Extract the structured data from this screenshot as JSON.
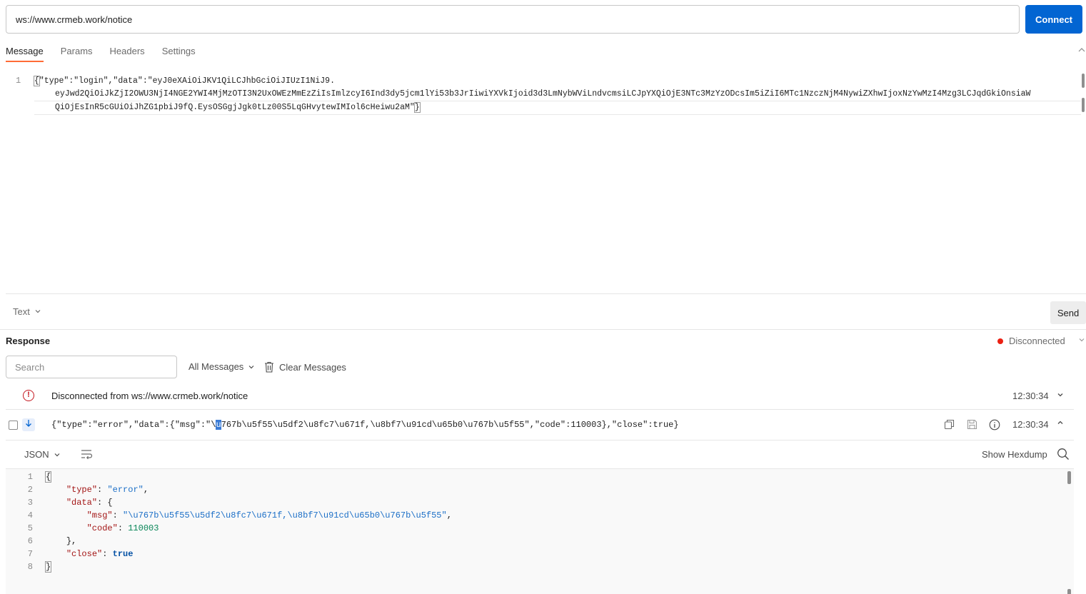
{
  "url_bar": {
    "value": "ws://www.crmeb.work/notice",
    "connect_label": "Connect"
  },
  "tabs": [
    {
      "label": "Message",
      "active": true
    },
    {
      "label": "Params",
      "active": false
    },
    {
      "label": "Headers",
      "active": false
    },
    {
      "label": "Settings",
      "active": false
    }
  ],
  "editor": {
    "line_number": "1",
    "line1_open": "{",
    "line1_rest": "\"type\":\"login\",\"data\":\"eyJ0eXAiOiJKV1QiLCJhbGciOiJIUzI1NiJ9.",
    "line2": "eyJwd2QiOiJkZjI2OWU3NjI4NGE2YWI4MjMzOTI3N2UxOWEzMmEzZiIsImlzcyI6Ind3dy5jcm1lYi53b3JrIiwiYXVkIjoid3d3LmNybWViLndvcmsiLCJpYXQiOjE3NTc3MzYzODcsIm5iZiI6MTc1NzczNjM4NywiZXhwIjoxNzYwMzI4Mzg3LCJqdGkiOnsiaW",
    "line3_rest": "QiOjEsInR5cGUiOiJhZG1pbiJ9fQ.EysOSGgjJgk0tLz00S5LqGHvytewIMIol6cHeiwu2aM\"",
    "line3_close": "}"
  },
  "body_type": {
    "label": "Text",
    "send_label": "Send"
  },
  "response": {
    "title": "Response",
    "status": "Disconnected",
    "status_color": "#eb2013",
    "search_placeholder": "Search",
    "all_messages_label": "All Messages",
    "clear_messages_label": "Clear Messages"
  },
  "messages": {
    "disconnect": {
      "icon": "error-icon",
      "text": "Disconnected from ws://www.crmeb.work/notice",
      "time": "12:30:34"
    },
    "received": {
      "icon": "arrow-down-icon",
      "text_before": "{\"type\":\"error\",\"data\":{\"msg\":\"\\",
      "text_selected": "u",
      "text_after": "767b\\u5f55\\u5df2\\u8fc7\\u671f,\\u8bf7\\u91cd\\u65b0\\u767b\\u5f55\",\"code\":110003},\"close\":true}",
      "time": "12:30:34"
    }
  },
  "json_view": {
    "format_label": "JSON",
    "hexdump_label": "Show Hexdump",
    "line_numbers": [
      "1",
      "2",
      "3",
      "4",
      "5",
      "6",
      "7",
      "8"
    ],
    "open_brace": "{",
    "close_brace": "}",
    "type_key": "\"type\"",
    "type_value": "\"error\"",
    "data_key": "\"data\"",
    "msg_key": "\"msg\"",
    "msg_value": "\"\\u767b\\u5f55\\u5df2\\u8fc7\\u671f,\\u8bf7\\u91cd\\u65b0\\u767b\\u5f55\"",
    "code_key": "\"code\"",
    "code_value": "110003",
    "close_key": "\"close\"",
    "close_value": "true"
  },
  "colors": {
    "accent": "#0265d2",
    "active_tab_underline": "#ff6c37",
    "disconnected_dot": "#eb2013"
  }
}
